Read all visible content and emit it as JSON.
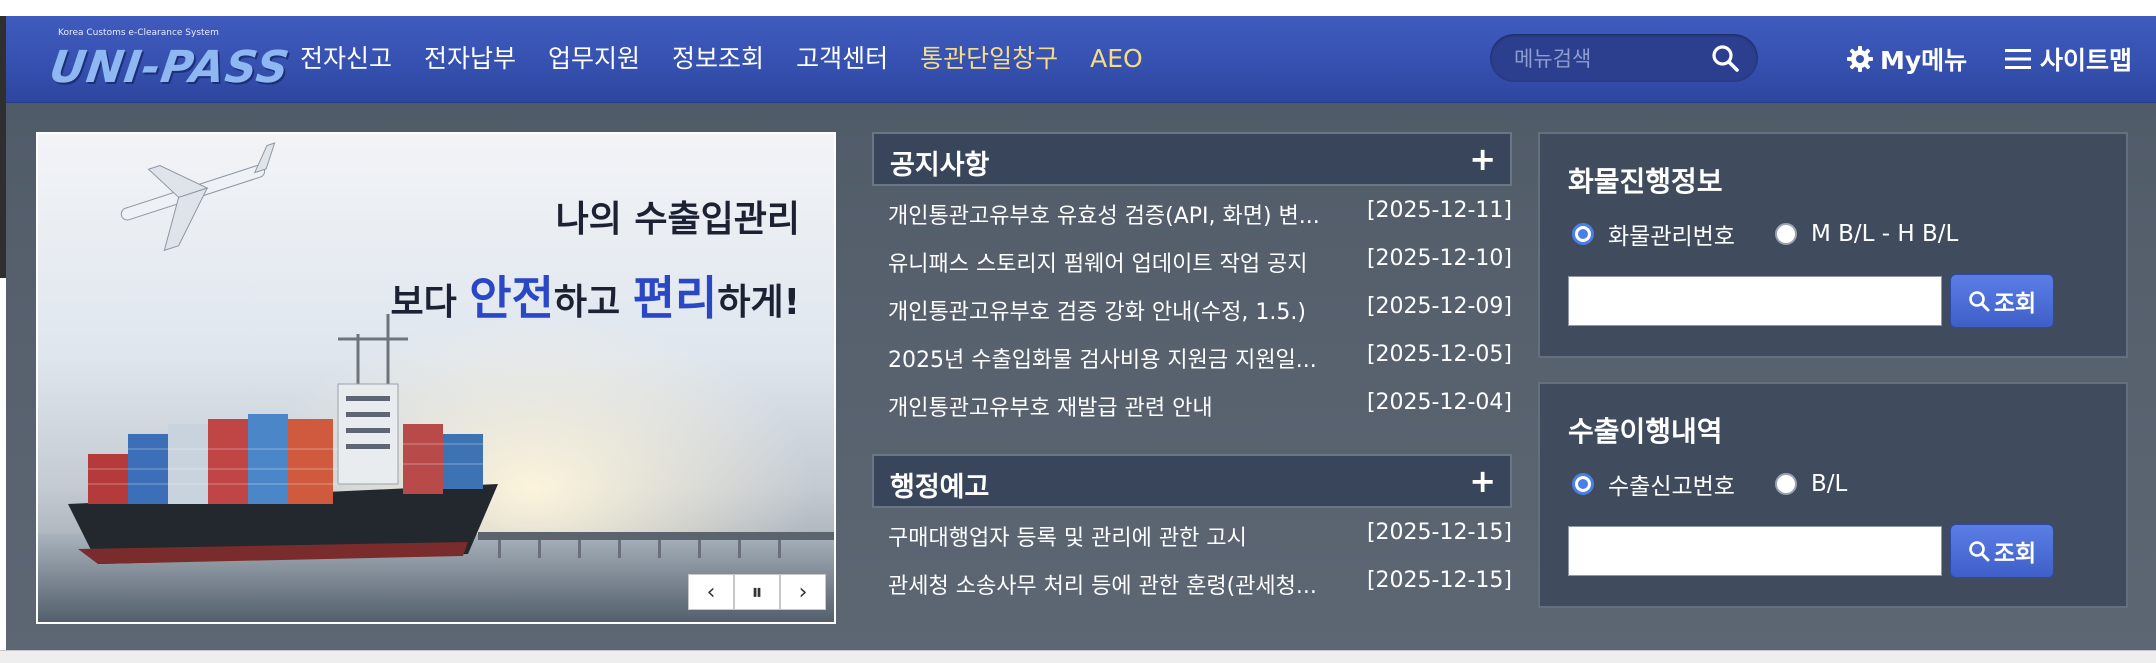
{
  "header": {
    "logo_small": "Korea Customs e-Clearance System",
    "logo_text": "UNI-PASS",
    "nav": [
      {
        "label": "전자신고"
      },
      {
        "label": "전자납부"
      },
      {
        "label": "업무지원"
      },
      {
        "label": "정보조회"
      },
      {
        "label": "고객센터"
      },
      {
        "label": "통관단일창구"
      },
      {
        "label": "AEO"
      }
    ],
    "search_placeholder": "메뉴검색",
    "mymenu_label": "My메뉴",
    "sitemap_label": "사이트맵"
  },
  "banner": {
    "line1": "나의 수출입관리",
    "line2_a": "보다 ",
    "line2_em1": "안전",
    "line2_b": "하고 ",
    "line2_em2": "편리",
    "line2_c": "하게!"
  },
  "notices": {
    "title": "공지사항",
    "items": [
      {
        "title": "개인통관고유부호 유효성 검증(API, 화면) 변...",
        "date": "[2025-12-11]"
      },
      {
        "title": "유니패스 스토리지 펌웨어 업데이트 작업 공지",
        "date": "[2025-12-10]"
      },
      {
        "title": "개인통관고유부호 검증 강화 안내(수정, 1.5.)",
        "date": "[2025-12-09]"
      },
      {
        "title": "2025년 수출입화물 검사비용 지원금 지원일...",
        "date": "[2025-12-05]"
      },
      {
        "title": "개인통관고유부호 재발급 관련 안내",
        "date": "[2025-12-04]"
      }
    ]
  },
  "admin_notices": {
    "title": "행정예고",
    "items": [
      {
        "title": "구매대행업자 등록 및 관리에 관한 고시",
        "date": "[2025-12-15]"
      },
      {
        "title": "관세청 소송사무 처리 등에 관한 훈령(관세청...",
        "date": "[2025-12-15]"
      }
    ]
  },
  "cargo": {
    "title": "화물진행정보",
    "options": [
      "화물관리번호",
      "M B/L - H B/L"
    ],
    "button": "조회"
  },
  "export": {
    "title": "수출이행내역",
    "options": [
      "수출신고번호",
      "B/L"
    ],
    "button": "조회"
  },
  "colors": {
    "header_blue": "#3651b0",
    "highlight_nav": "#f5dc85",
    "panel_bg": "#404b5d",
    "accent_blue": "#4a7fe6"
  }
}
